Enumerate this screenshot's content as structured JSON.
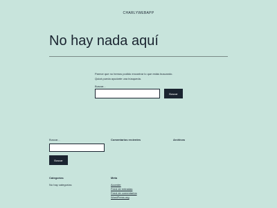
{
  "site": {
    "title": "CHARLYWEBAPP"
  },
  "main": {
    "heading": "No hay nada aquí",
    "message_line1": "Parece que no hemos podido encontrar lo que estás buscando.",
    "message_line2": "Quizá pueda ayudarte una búsqueda.",
    "search_label": "Buscar...",
    "search_button": "Buscar"
  },
  "footer": {
    "search": {
      "label": "Buscar...",
      "button": "Buscar"
    },
    "recent_comments": {
      "heading": "Comentarios recientes"
    },
    "archives": {
      "heading": "Archivos"
    },
    "categories": {
      "heading": "Categorías",
      "empty": "No hay categorías"
    },
    "meta": {
      "heading": "Meta",
      "links": [
        "Acceder",
        "Feed de entradas",
        "Feed de comentarios",
        "WordPress.org"
      ]
    }
  }
}
